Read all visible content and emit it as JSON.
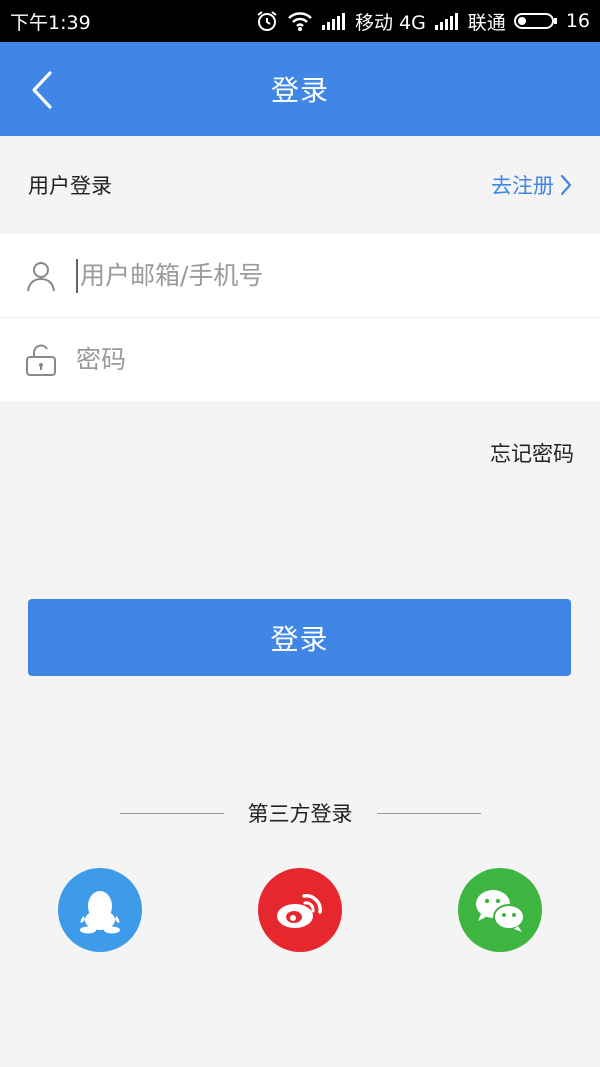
{
  "status_bar": {
    "time": "下午1:39",
    "carrier1": "移动 4G",
    "carrier2": "联通",
    "battery": "16"
  },
  "app_bar": {
    "title": "登录",
    "back_icon": "chevron-left-icon"
  },
  "section": {
    "label": "用户登录",
    "register_link": "去注册"
  },
  "form": {
    "username": {
      "value": "",
      "placeholder": "用户邮箱/手机号",
      "icon": "user-icon"
    },
    "password": {
      "value": "",
      "placeholder": "密码",
      "icon": "lock-icon"
    }
  },
  "forgot_password": "忘记密码",
  "login_button": "登录",
  "third_party": {
    "title": "第三方登录",
    "providers": [
      {
        "name": "qq",
        "icon": "qq-penguin-icon",
        "color": "#3d9be9"
      },
      {
        "name": "weibo",
        "icon": "weibo-icon",
        "color": "#e6272d"
      },
      {
        "name": "wechat",
        "icon": "wechat-icon",
        "color": "#3db540"
      }
    ]
  },
  "colors": {
    "primary": "#3f86e6",
    "background": "#f4f4f4"
  }
}
